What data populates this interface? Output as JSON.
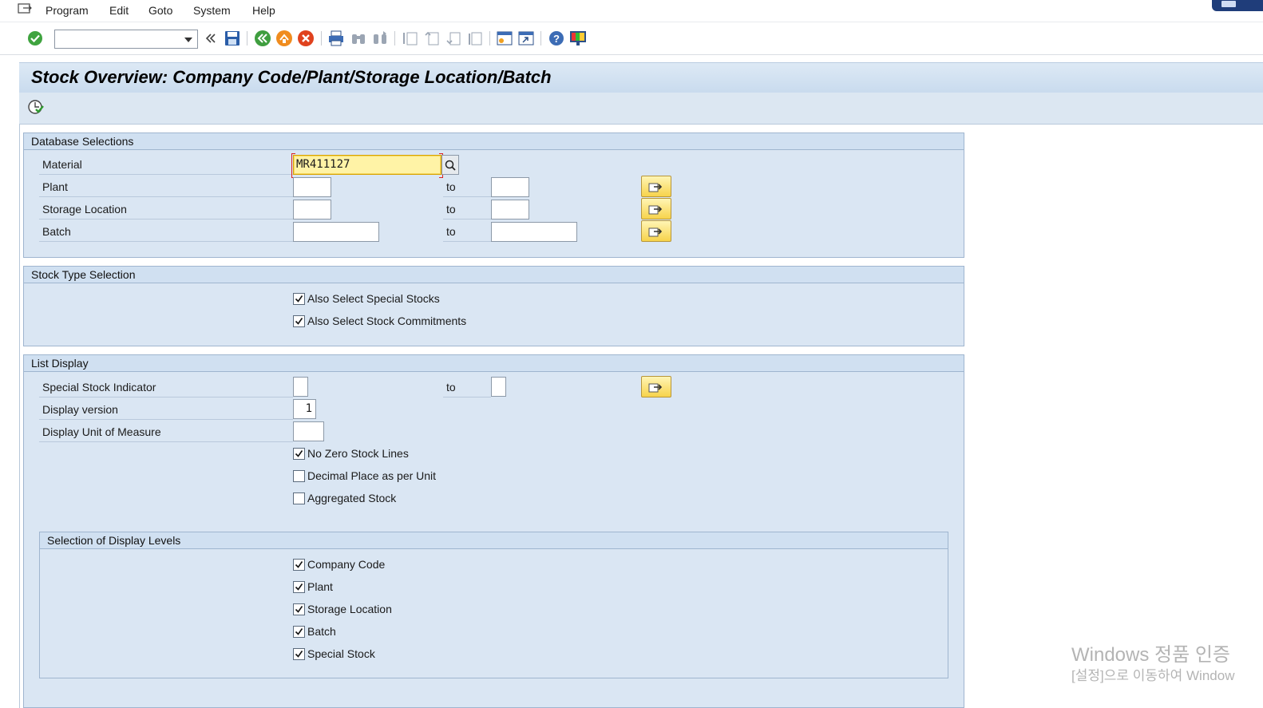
{
  "menu": {
    "items": [
      {
        "label": "Program"
      },
      {
        "label": "Edit"
      },
      {
        "label": "Goto"
      },
      {
        "label": "System"
      },
      {
        "label": "Help"
      }
    ]
  },
  "toolbar": {
    "command_field_value": "",
    "icons": [
      "enter-icon",
      "back-double-arrow-icon",
      "save-icon",
      "back-icon",
      "exit-icon",
      "cancel-icon",
      "print-icon",
      "find-icon",
      "find-next-icon",
      "first-page-icon",
      "previous-page-icon",
      "next-page-icon",
      "last-page-icon",
      "create-session-icon",
      "shortcut-icon",
      "help-icon",
      "customize-layout-icon"
    ]
  },
  "page": {
    "title": "Stock Overview: Company Code/Plant/Storage Location/Batch"
  },
  "database_selections": {
    "header": "Database Selections",
    "to_label": "to",
    "material": {
      "label": "Material",
      "value": "MR411127"
    },
    "plant": {
      "label": "Plant",
      "from": "",
      "to": ""
    },
    "storage_location": {
      "label": "Storage Location",
      "from": "",
      "to": ""
    },
    "batch": {
      "label": "Batch",
      "from": "",
      "to": ""
    }
  },
  "stock_type_selection": {
    "header": "Stock Type Selection",
    "special_stocks": {
      "label": "Also Select Special Stocks",
      "checked": true
    },
    "stock_commitments": {
      "label": "Also Select Stock Commitments",
      "checked": true
    }
  },
  "list_display": {
    "header": "List Display",
    "to_label": "to",
    "special_stock_indicator": {
      "label": "Special Stock Indicator",
      "from": "",
      "to": ""
    },
    "display_version": {
      "label": "Display version",
      "value": "1"
    },
    "display_uom": {
      "label": "Display Unit of Measure",
      "value": ""
    },
    "no_zero_stock": {
      "label": "No Zero Stock Lines",
      "checked": true
    },
    "decimal_place": {
      "label": "Decimal Place as per Unit",
      "checked": false
    },
    "aggregated_stock": {
      "label": "Aggregated Stock",
      "checked": false
    }
  },
  "display_levels": {
    "header": "Selection of Display Levels",
    "company_code": {
      "label": "Company Code",
      "checked": true
    },
    "plant": {
      "label": "Plant",
      "checked": true
    },
    "storage_location": {
      "label": "Storage Location",
      "checked": true
    },
    "batch": {
      "label": "Batch",
      "checked": true
    },
    "special_stock": {
      "label": "Special Stock",
      "checked": true
    }
  },
  "watermark": {
    "line1": "Windows 정품 인증",
    "line2": "[설정]으로 이동하여 Window"
  },
  "colors": {
    "group_bg": "#dae6f3",
    "title_bg": "#c9dbee",
    "active_field": "#fff3a6",
    "multi_selection_button": "#f7d34b"
  }
}
